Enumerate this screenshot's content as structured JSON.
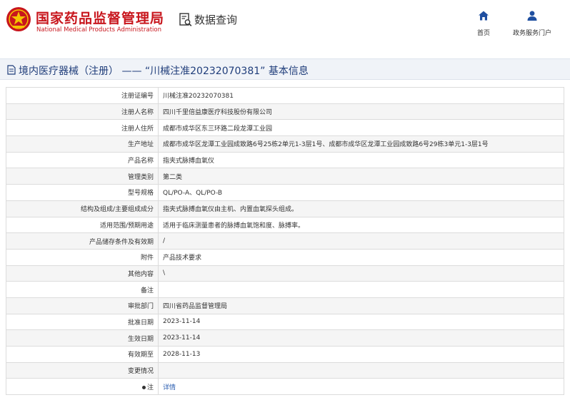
{
  "header": {
    "agency_cn": "国家药品监督管理局",
    "agency_en": "National Medical Products Administration",
    "query_label": "数据查询",
    "brand_color": "#c8161d",
    "nav": [
      {
        "label": "首页",
        "icon": "home-icon"
      },
      {
        "label": "政务服务门户",
        "icon": "user-icon"
      }
    ]
  },
  "title_bar": {
    "title": "境内医疗器械（注册） —— “川械注准20232070381” 基本信息",
    "color": "#1f3d7a"
  },
  "rows": [
    {
      "label": "注册证编号",
      "value": "川械注准20232070381"
    },
    {
      "label": "注册人名称",
      "value": "四川千里倍益康医疗科技股份有限公司"
    },
    {
      "label": "注册人住所",
      "value": "成都市成华区东三环路二段龙潭工业园"
    },
    {
      "label": "生产地址",
      "value": "成都市成华区龙潭工业园成致路6号25栋2单元1-3层1号、成都市成华区龙潭工业园成致路6号29栋3单元1-3层1号"
    },
    {
      "label": "产品名称",
      "value": "指夹式脉搏血氧仪"
    },
    {
      "label": "管理类别",
      "value": "第二类"
    },
    {
      "label": "型号规格",
      "value": "QL/PO-A、QL/PO-B"
    },
    {
      "label": "结构及组成/主要组成成分",
      "value": "指夹式脉搏血氧仪由主机、内置血氧探头组成。"
    },
    {
      "label": "适用范围/预期用途",
      "value": "适用于临床测量患者的脉搏血氧饱和度、脉搏率。"
    },
    {
      "label": "产品储存条件及有效期",
      "value": "/"
    },
    {
      "label": "附件",
      "value": "产品技术要求"
    },
    {
      "label": "其他内容",
      "value": "\\"
    },
    {
      "label": "备注",
      "value": ""
    },
    {
      "label": "审批部门",
      "value": "四川省药品监督管理局"
    },
    {
      "label": "批准日期",
      "value": "2023-11-14"
    },
    {
      "label": "生效日期",
      "value": "2023-11-14"
    },
    {
      "label": "有效期至",
      "value": "2028-11-13"
    },
    {
      "label": "变更情况",
      "value": ""
    }
  ],
  "note_row": {
    "label": "注",
    "link": "详情"
  }
}
